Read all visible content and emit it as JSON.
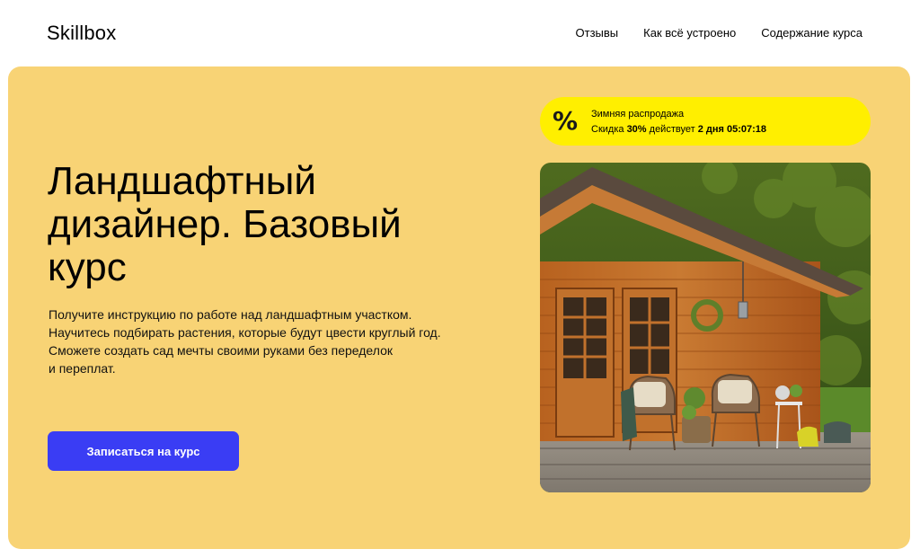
{
  "header": {
    "logo": "Skillbox",
    "nav": [
      "Отзывы",
      "Как всё устроено",
      "Содержание курса"
    ]
  },
  "hero": {
    "title_lines": [
      "Ландшафтный",
      "дизайнер. Базовый",
      "курс"
    ],
    "description_lines": [
      "Получите инструкцию по работе над ландшафтным участком.",
      "Научитесь подбирать растения, которые будут цвести круглый год.",
      "Сможете создать сад мечты своими руками без переделок",
      "и переплат."
    ],
    "cta_label": "Записаться на курс"
  },
  "sale": {
    "icon": "%",
    "title": "Зимняя распродажа",
    "text_prefix": "Скидка ",
    "discount": "30%",
    "text_middle": " действует ",
    "days": "2 дня",
    "timer": "05:07:18"
  },
  "colors": {
    "hero_bg": "#f8d375",
    "cta_bg": "#3a3df4",
    "sale_bg": "#ffef00"
  }
}
